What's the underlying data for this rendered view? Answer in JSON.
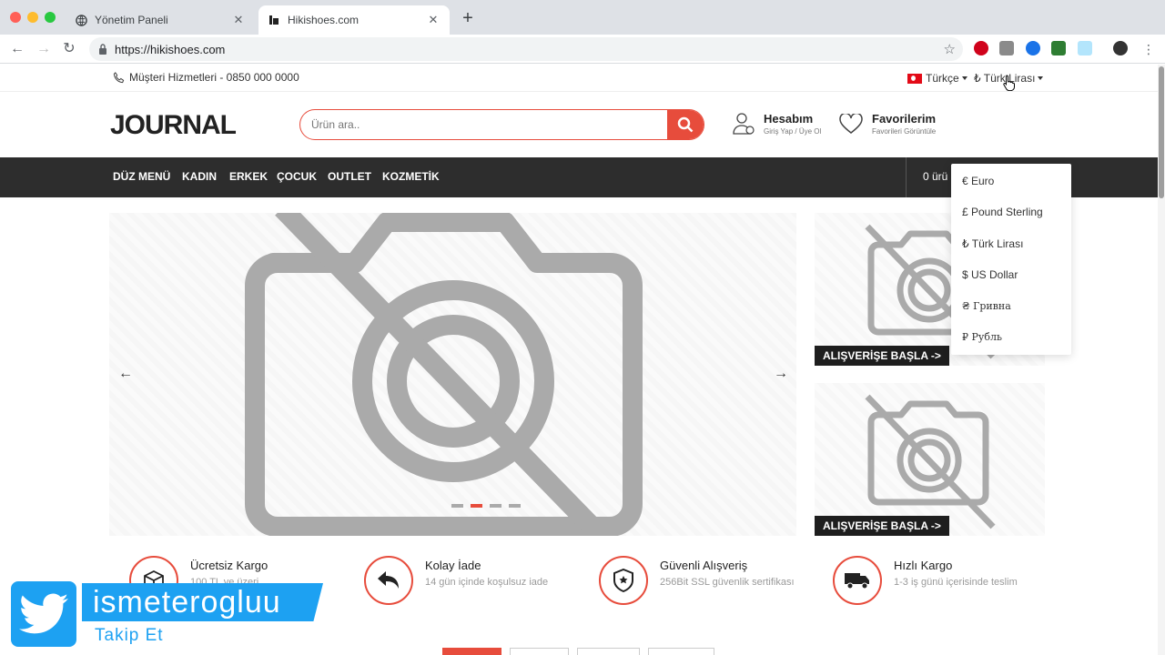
{
  "browser": {
    "tabs": [
      {
        "label": "Yönetim Paneli",
        "close": "✕"
      },
      {
        "label": "Hikishoes.com",
        "close": "✕"
      }
    ],
    "new_tab": "+",
    "url": "https://hikishoes.com",
    "nav": {
      "back": "←",
      "forward": "→",
      "reload": "↻"
    },
    "star": "☆"
  },
  "topbar": {
    "phone": "Müşteri Hizmetleri - 0850 000 0000",
    "language": "Türkçe",
    "currency": "₺ Türk Lirası"
  },
  "header": {
    "logo": "JOURNAL",
    "search_placeholder": "Ürün ara..",
    "account_title": "Hesabım",
    "account_sub": "Giriş Yap / Üye Ol",
    "fav_title": "Favorilerim",
    "fav_sub": "Favorileri Görüntüle"
  },
  "menu": [
    "DÜZ MENÜ",
    "KADIN",
    "ERKEK",
    "ÇOCUK",
    "OUTLET",
    "KOZMETİK"
  ],
  "cart_label": "0 ürü",
  "slider": {
    "prev": "←",
    "next": "→"
  },
  "banners": [
    {
      "button": "ALIŞVERİŞE BAŞLA ->"
    },
    {
      "button": "ALIŞVERİŞE BAŞLA ->"
    }
  ],
  "currency_options": [
    "€ Euro",
    "£ Pound Sterling",
    "₺ Türk Lirası",
    "$ US Dollar",
    "₴ Гривна",
    "₽ Рубль"
  ],
  "features": [
    {
      "title": "Ücretsiz Kargo",
      "sub": "100 TL ve üzeri"
    },
    {
      "title": "Kolay İade",
      "sub": "14 gün içinde koşulsuz iade"
    },
    {
      "title": "Güvenli Alışveriş",
      "sub": "256Bit SSL güvenlik sertifikası"
    },
    {
      "title": "Hızlı Kargo",
      "sub": "1-3 iş günü içerisinde teslim"
    }
  ],
  "overlay": {
    "handle": "ismeterogluu",
    "follow": "Takip Et"
  },
  "colors": {
    "accent": "#e74c3c",
    "nav_bg": "#2d2d2d",
    "twitter": "#1da1f2"
  }
}
